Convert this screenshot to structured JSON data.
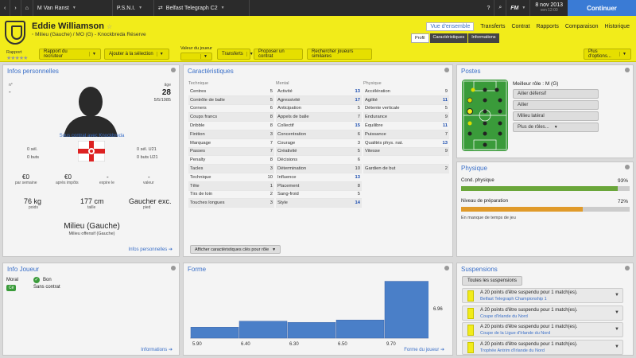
{
  "topbar": {
    "manager": "M Van Ranst",
    "club": "P.S.N.I.",
    "breadcrumb": "Belfast Telegraph C2",
    "date": "8 nov 2013",
    "day_time": "ven 12:00",
    "fm_label": "FM",
    "continue_label": "Continuer"
  },
  "player": {
    "name": "Eddie Williamson",
    "subtitle": "Milieu (Gauche) / MO (G) - Knockbreda Réserve",
    "rapport_label": "Rapport",
    "stars": "★★★★★"
  },
  "nav": [
    "Vue d'ensemble",
    "Transferts",
    "Contrat",
    "Rapports",
    "Comparaison",
    "Historique"
  ],
  "subtabs": [
    "Profil",
    "Caractéristiques",
    "Informations"
  ],
  "actions": {
    "report": "Rapport du recruteur",
    "add_selection": "Ajouter à la sélection",
    "value_label": "Valeur du joueur",
    "transfers": "Transferts",
    "propose_contract": "Proposer un contrat",
    "find_similar": "Rechercher joueurs similaires",
    "more_options": "Plus d'options..."
  },
  "personal": {
    "title": "Infos personnelles",
    "no_label": "n°",
    "no_value": "-",
    "age_label": "âge",
    "age": "28",
    "dob": "5/5/1985",
    "contract": "Sous contrat avec Knockbreda",
    "caps_left": "0 sél.",
    "goals_left": "0 buts",
    "caps_right": "0 sél. U21",
    "goals_right": "0 buts U21",
    "wage": "€0",
    "wage_label": "par semaine",
    "after_tax": "€0",
    "after_tax_label": "après impôts",
    "expiry": "-",
    "expiry_label": "expire le",
    "value": "-",
    "value_label": "valeur",
    "weight": "76 kg",
    "weight_label": "poids",
    "height": "177 cm",
    "height_label": "taille",
    "foot": "Gaucher exc.",
    "foot_label": "pied",
    "position": "Milieu (Gauche)",
    "position_sub": "Milieu offensif (Gauche)",
    "link": "Infos personnelles"
  },
  "attributes": {
    "title": "Caractéristiques",
    "technique_label": "Technique",
    "mental_label": "Mental",
    "physique_label": "Physique",
    "technique": [
      {
        "name": "Centres",
        "value": "5",
        "hi": false
      },
      {
        "name": "Contrôle de balle",
        "value": "5",
        "hi": false
      },
      {
        "name": "Corners",
        "value": "6",
        "hi": false
      },
      {
        "name": "Coups francs",
        "value": "8",
        "hi": false
      },
      {
        "name": "Dribble",
        "value": "8",
        "hi": false
      },
      {
        "name": "Finition",
        "value": "3",
        "hi": false
      },
      {
        "name": "Marquage",
        "value": "7",
        "hi": false
      },
      {
        "name": "Passes",
        "value": "7",
        "hi": false
      },
      {
        "name": "Penalty",
        "value": "8",
        "hi": false
      },
      {
        "name": "Tacles",
        "value": "3",
        "hi": false
      },
      {
        "name": "Technique",
        "value": "10",
        "hi": false
      },
      {
        "name": "Tête",
        "value": "1",
        "hi": false
      },
      {
        "name": "Tirs de loin",
        "value": "2",
        "hi": false
      },
      {
        "name": "Touches longues",
        "value": "3",
        "hi": false
      }
    ],
    "mental": [
      {
        "name": "Activité",
        "value": "13",
        "hi": true
      },
      {
        "name": "Agressivité",
        "value": "17",
        "hi": true
      },
      {
        "name": "Anticipation",
        "value": "5",
        "hi": false
      },
      {
        "name": "Appels de balle",
        "value": "7",
        "hi": false
      },
      {
        "name": "Collectif",
        "value": "15",
        "hi": true
      },
      {
        "name": "Concentration",
        "value": "6",
        "hi": false
      },
      {
        "name": "Courage",
        "value": "3",
        "hi": false
      },
      {
        "name": "Créativité",
        "value": "5",
        "hi": false
      },
      {
        "name": "Décisions",
        "value": "6",
        "hi": false
      },
      {
        "name": "Détermination",
        "value": "10",
        "hi": false
      },
      {
        "name": "Influence",
        "value": "13",
        "hi": true
      },
      {
        "name": "Placement",
        "value": "8",
        "hi": false
      },
      {
        "name": "Sang-froid",
        "value": "5",
        "hi": false
      },
      {
        "name": "Style",
        "value": "14",
        "hi": true
      }
    ],
    "physique": [
      {
        "name": "Accélération",
        "value": "9",
        "hi": false
      },
      {
        "name": "Agilité",
        "value": "11",
        "hi": true
      },
      {
        "name": "Détente verticale",
        "value": "5",
        "hi": false
      },
      {
        "name": "Endurance",
        "value": "9",
        "hi": false
      },
      {
        "name": "Équilibre",
        "value": "11",
        "hi": true
      },
      {
        "name": "Puissance",
        "value": "7",
        "hi": false
      },
      {
        "name": "Qualités phys. nat.",
        "value": "13",
        "hi": true
      },
      {
        "name": "Vitesse",
        "value": "9",
        "hi": false
      },
      {
        "name": "",
        "value": "",
        "hi": false
      },
      {
        "name": "Gardien de but",
        "value": "2",
        "hi": false
      }
    ],
    "key_button": "Afficher caractéristiques clés pour rôle"
  },
  "positions": {
    "title": "Postes",
    "best_role": "Meilleur rôle : M (G)",
    "roles": [
      "Ailier défensif",
      "Ailier",
      "Milieu latéral",
      "Plus de rôles..."
    ]
  },
  "physique": {
    "title": "Physique",
    "condition_label": "Cond. physique",
    "condition_value": "93%",
    "condition": 0.93,
    "prep_label": "Niveau de préparation",
    "prep_value": "72%",
    "prep": 0.72,
    "note": "En manque de temps de jeu",
    "condition_color": "#6aa63a",
    "prep_color": "#e09a2a"
  },
  "info": {
    "title": "Info Joueur",
    "morale_label": "Moral",
    "morale_value": "Bon",
    "badge": "Cé",
    "contract_status": "Sans contrat",
    "link": "Informations"
  },
  "form": {
    "title": "Forme",
    "link": "Forme du joueur",
    "avg": "6.96"
  },
  "chart_data": {
    "type": "bar",
    "categories": [
      "1",
      "2",
      "3",
      "4",
      "5"
    ],
    "values": [
      5.9,
      6.4,
      6.3,
      6.5,
      9.7
    ],
    "labels": [
      "5.90",
      "6.40",
      "6.30",
      "6.50",
      "9.70"
    ],
    "ylim": [
      5.0,
      10.0
    ],
    "color": "#4a7fc8"
  },
  "suspensions": {
    "title": "Suspensions",
    "all_button": "Toutes les suspensions",
    "items": [
      {
        "text": "A 20 points d'être suspendu pour 1 match(es).",
        "comp": "Belfast Telegraph Championship 1"
      },
      {
        "text": "A 20 points d'être suspendu pour 1 match(es).",
        "comp": "Coupe d'Irlande du Nord"
      },
      {
        "text": "A 20 points d'être suspendu pour 1 match(es).",
        "comp": "Coupe de la Ligue d'Irlande du Nord"
      },
      {
        "text": "A 20 points d'être suspendu pour 1 match(es).",
        "comp": "Trophée Antrim d'Irlande du Nord"
      }
    ]
  }
}
